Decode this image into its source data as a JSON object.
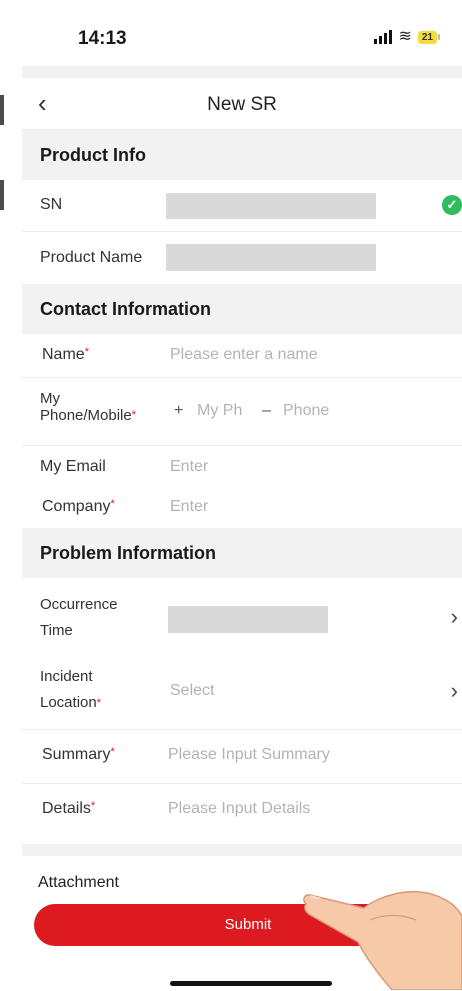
{
  "status_bar": {
    "time": "14:13",
    "battery": "21"
  },
  "navbar": {
    "title": "New SR"
  },
  "sections": {
    "product": "Product Info",
    "contact": "Contact Information",
    "problem": "Problem Information"
  },
  "product": {
    "sn_label": "SN",
    "product_name_label": "Product Name"
  },
  "contact": {
    "name_label": "Name",
    "name_placeholder": "Please enter a name",
    "phone_label_line1": "My",
    "phone_label_line2": "Phone/Mobile",
    "phone_plus": "+",
    "phone_code_placeholder": "My Ph",
    "phone_dash": "–",
    "phone_placeholder": "Phone",
    "email_label": "My Email",
    "email_placeholder": "Enter",
    "company_label": "Company",
    "company_placeholder": "Enter"
  },
  "problem": {
    "occurrence_label_line1": "Occurrence",
    "occurrence_label_line2": "Time",
    "location_label_line1": "Incident",
    "location_label_line2": "Location",
    "location_placeholder": "Select",
    "summary_label": "Summary",
    "summary_placeholder": "Please Input Summary",
    "details_label": "Details",
    "details_placeholder": "Please Input Details"
  },
  "attachment_label": "Attachment",
  "submit_label": "Submit",
  "required_mark": "*",
  "colors": {
    "accent": "#dc1a1f",
    "success": "#2fbc5d",
    "section_bg": "#f2f2f2"
  },
  "icons": [
    "back-chevron-icon",
    "check-icon",
    "chevron-right-icon",
    "signal-icon",
    "wifi-icon",
    "battery-icon",
    "hand-pointer-icon"
  ]
}
